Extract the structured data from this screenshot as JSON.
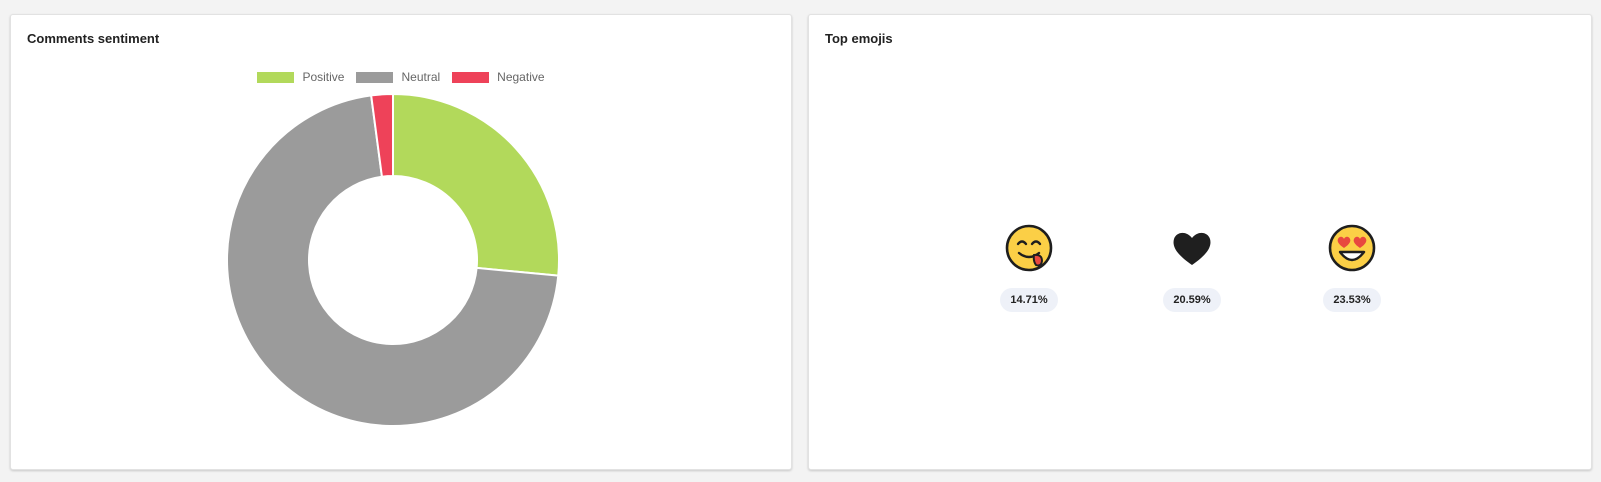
{
  "sentiment_card": {
    "title": "Comments sentiment",
    "legend": [
      {
        "label": "Positive",
        "color": "#b2d95b"
      },
      {
        "label": "Neutral",
        "color": "#9b9b9b"
      },
      {
        "label": "Negative",
        "color": "#ee4259"
      }
    ]
  },
  "chart_data": {
    "type": "pie",
    "donut": true,
    "categories": [
      "Positive",
      "Neutral",
      "Negative"
    ],
    "values": [
      26.5,
      71.4,
      2.1
    ],
    "colors": [
      "#b2d95b",
      "#9b9b9b",
      "#ee4259"
    ],
    "legend_position": "top-center"
  },
  "emojis_card": {
    "title": "Top emojis",
    "emojis": [
      {
        "icon": "yum-face-icon",
        "percent": "14.71%"
      },
      {
        "icon": "black-heart-icon",
        "percent": "20.59%"
      },
      {
        "icon": "heart-eyes-face-icon",
        "percent": "23.53%"
      }
    ]
  }
}
